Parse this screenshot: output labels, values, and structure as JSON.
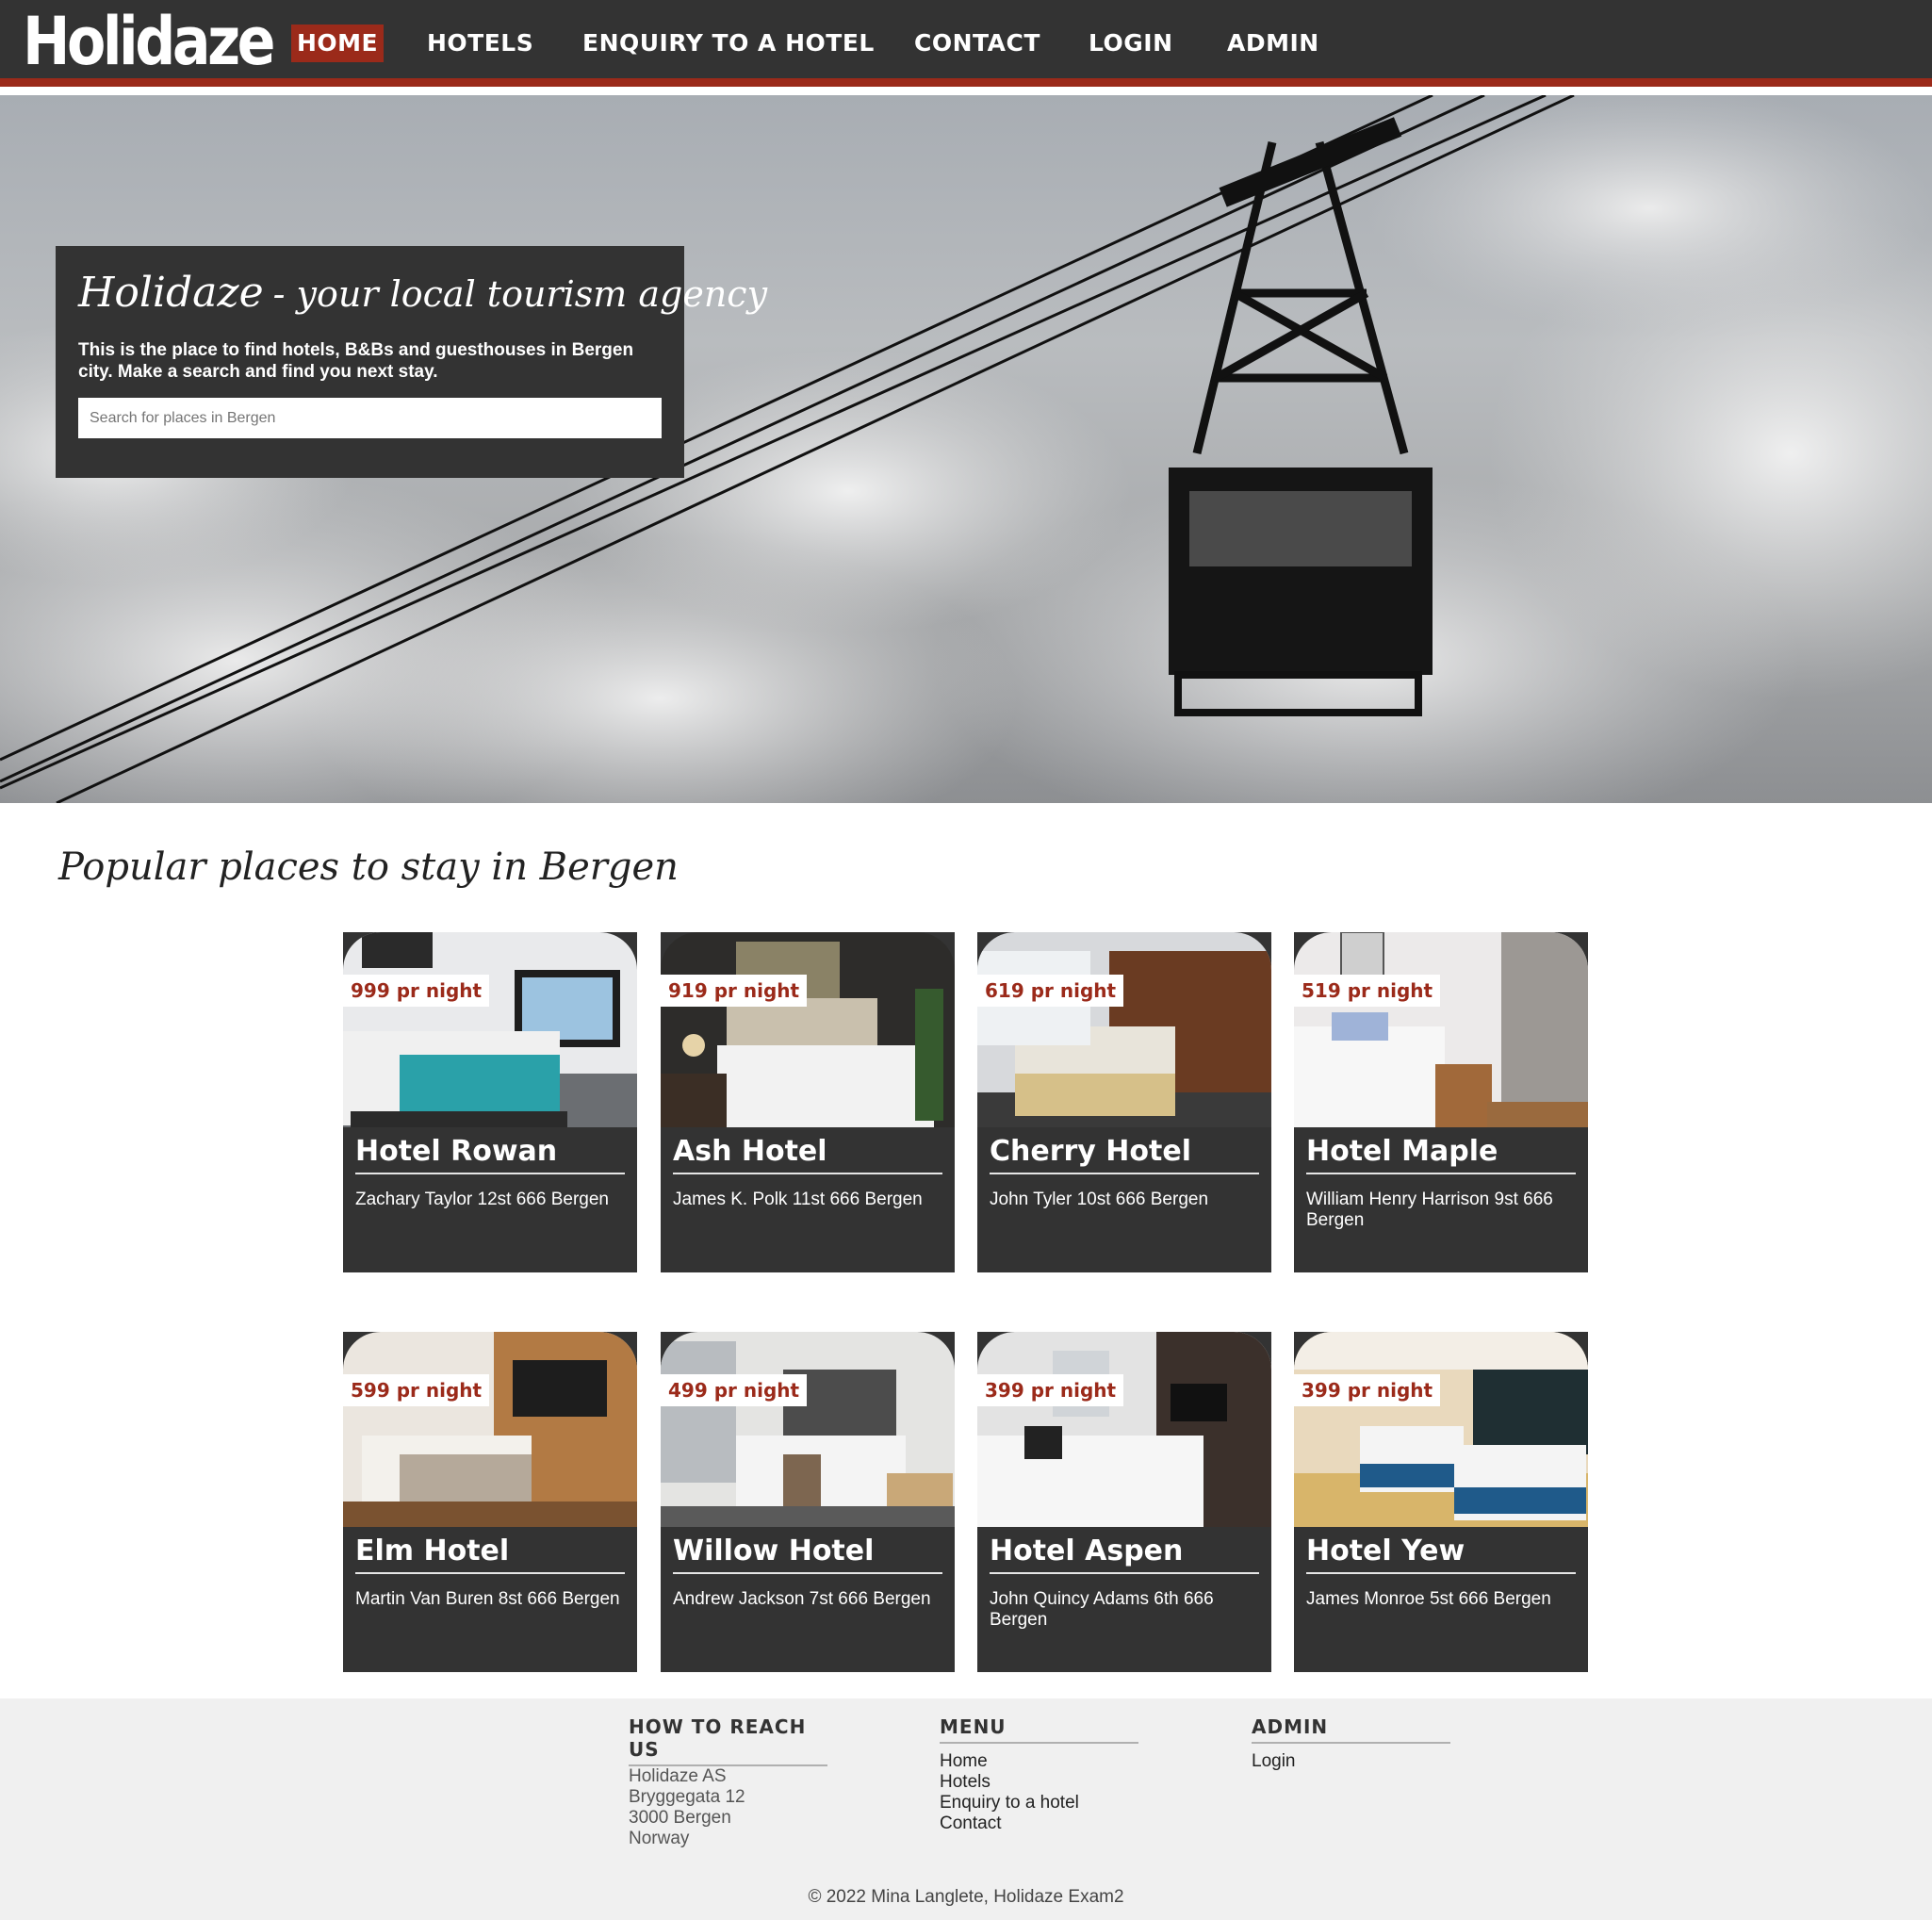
{
  "nav": {
    "logo": "Holidaze",
    "items": [
      {
        "label": "HOME",
        "active": true
      },
      {
        "label": "HOTELS",
        "active": false
      },
      {
        "label": "ENQUIRY TO A HOTEL",
        "active": false
      },
      {
        "label": "CONTACT",
        "active": false
      },
      {
        "label": "LOGIN",
        "active": false
      },
      {
        "label": "ADMIN",
        "active": false
      }
    ]
  },
  "hero": {
    "title": "Holidaze",
    "tagline": "- your local tourism agency",
    "description": "This is the place to find hotels, B&Bs and guesthouses in Bergen city. Make a search and find you next stay.",
    "search_placeholder": "Search for places in Bergen"
  },
  "popular": {
    "title": "Popular places to stay in Bergen",
    "hotels": [
      {
        "price": "999 pr night",
        "name": "Hotel Rowan",
        "address": "Zachary Taylor 12st 666 Bergen"
      },
      {
        "price": "919 pr night",
        "name": "Ash Hotel",
        "address": "James K. Polk 11st 666 Bergen"
      },
      {
        "price": "619 pr night",
        "name": "Cherry Hotel",
        "address": "John Tyler 10st 666 Bergen"
      },
      {
        "price": "519 pr night",
        "name": "Hotel Maple",
        "address": "William Henry Harrison 9st 666 Bergen"
      },
      {
        "price": "599 pr night",
        "name": "Elm Hotel",
        "address": "Martin Van Buren 8st 666 Bergen"
      },
      {
        "price": "499 pr night",
        "name": "Willow Hotel",
        "address": "Andrew Jackson 7st 666 Bergen"
      },
      {
        "price": "399 pr night",
        "name": "Hotel Aspen",
        "address": "John Quincy Adams 6th 666 Bergen"
      },
      {
        "price": "399 pr night",
        "name": "Hotel Yew",
        "address": "James Monroe 5st 666 Bergen"
      }
    ]
  },
  "footer": {
    "reach": {
      "heading": "HOW TO REACH US",
      "lines": [
        "Holidaze AS",
        "Bryggegata 12",
        "3000 Bergen",
        "Norway"
      ]
    },
    "menu": {
      "heading": "MENU",
      "links": [
        "Home",
        "Hotels",
        "Enquiry to a hotel",
        "Contact"
      ]
    },
    "admin": {
      "heading": "ADMIN",
      "links": [
        "Login"
      ]
    },
    "copyright": "© 2022 Mina Langlete, Holidaze Exam2"
  },
  "colors": {
    "dark": "#333333",
    "accent": "#9b2a1a",
    "footer_bg": "#f0f0f0"
  }
}
